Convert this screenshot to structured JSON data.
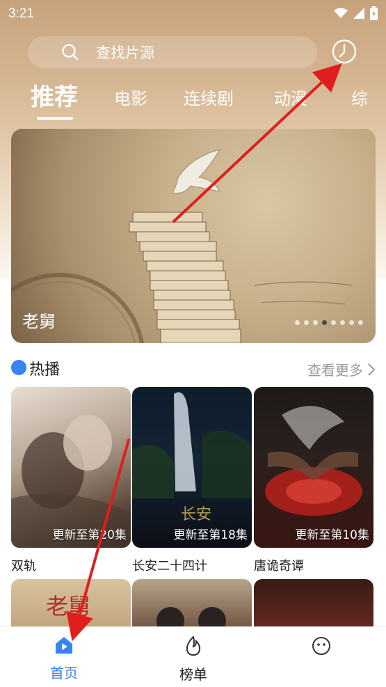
{
  "status": {
    "time": "3:21"
  },
  "search": {
    "placeholder": "查找片源"
  },
  "tabs": [
    {
      "label": "推荐",
      "active": true
    },
    {
      "label": "电影"
    },
    {
      "label": "连续剧"
    },
    {
      "label": "动漫"
    },
    {
      "label": "综"
    }
  ],
  "banner": {
    "title": "老舅",
    "dot_count": 8,
    "active_index": 3
  },
  "section": {
    "title": "热播",
    "more_label": "查看更多"
  },
  "cards": [
    {
      "title": "双轨",
      "badge": "更新至第20集"
    },
    {
      "title": "长安二十四计",
      "badge": "更新至第18集"
    },
    {
      "title": "唐诡奇谭",
      "badge": "更新至第10集"
    }
  ],
  "nav": [
    {
      "label": "首页",
      "active": true
    },
    {
      "label": "榜单"
    },
    {
      "label": ""
    }
  ],
  "colors": {
    "accent": "#3a84f0",
    "annotation": "#e01e1e"
  }
}
